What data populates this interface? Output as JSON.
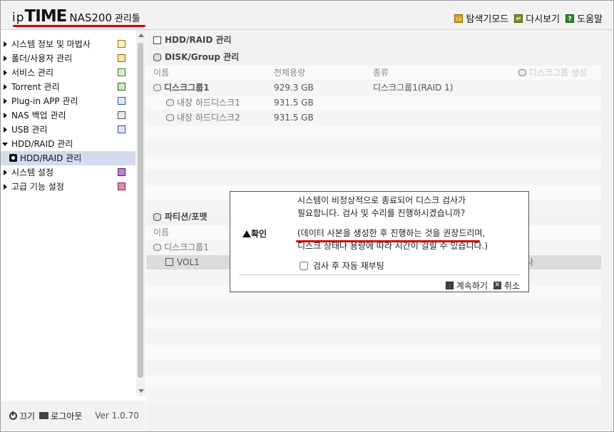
{
  "header": {
    "logo_ip": "ip",
    "logo_time": "TIME",
    "logo_nas": "NAS200",
    "logo_tool": "관리툴",
    "links": [
      {
        "icon": "explorer-mode-icon",
        "label": "탐색기모드"
      },
      {
        "icon": "refresh-icon",
        "label": "다시보기"
      },
      {
        "icon": "help-icon",
        "label": "도움말"
      }
    ]
  },
  "sidebar": {
    "items": [
      {
        "label": "시스템 정보 및 마법사",
        "icon": "chart-icon"
      },
      {
        "label": "폴더/사용자 관리",
        "icon": "folder-user-icon"
      },
      {
        "label": "서비스 관리",
        "icon": "service-icon"
      },
      {
        "label": "Torrent 관리",
        "icon": "torrent-icon"
      },
      {
        "label": "Plug-in APP 관리",
        "icon": "plugin-icon"
      },
      {
        "label": "NAS 백업 관리",
        "icon": "backup-icon"
      },
      {
        "label": "USB 관리",
        "icon": "usb-icon"
      },
      {
        "label": "HDD/RAID 관리",
        "icon": ""
      },
      {
        "label": "HDD/RAID 관리",
        "icon": "hdd-icon"
      },
      {
        "label": "시스템 설정",
        "icon": "system-settings-icon"
      },
      {
        "label": "고급 기능 설정",
        "icon": "advanced-settings-icon"
      }
    ]
  },
  "footer": {
    "power": "끄기",
    "logout": "로그아웃",
    "version": "Ver 1.0.70"
  },
  "main": {
    "title": "HDD/RAID 관리",
    "disk_section": {
      "title": "DISK/Group 관리",
      "headers": [
        "이름",
        "전체용량",
        "종류"
      ],
      "create_label": "디스크그룹 생성",
      "rows": [
        {
          "name": "디스크그룹1",
          "size": "929.3 GB",
          "type": "디스크그룹1(RAID 1)"
        },
        {
          "name": "내장 하드디스크1",
          "size": "931.5 GB",
          "type": ""
        },
        {
          "name": "내장 하드디스크2",
          "size": "931.5 GB",
          "type": ""
        }
      ]
    },
    "partition_section": {
      "title": "파티션/포맷",
      "header_name": "이름",
      "group": "디스크그룹1",
      "volume": "VOL1",
      "volume_right": "사"
    }
  },
  "dialog": {
    "label": "확인",
    "line1": "시스템이 비정상적으로 종료되어 디스크 검사가",
    "line2": "필요합니다. 검사 및 수리를 진행하시겠습니까?",
    "line3": "(데이터 사본을 생성한 후 진행하는 것을 권장드리며,",
    "line4": "디스크 상태나 용량에 따라 시간이 걸릴 수 있습니다.)",
    "checkbox_label": "검사 후 자동 재부팅",
    "checkbox_checked": false,
    "continue_label": "계속하기",
    "cancel_label": "취소"
  }
}
